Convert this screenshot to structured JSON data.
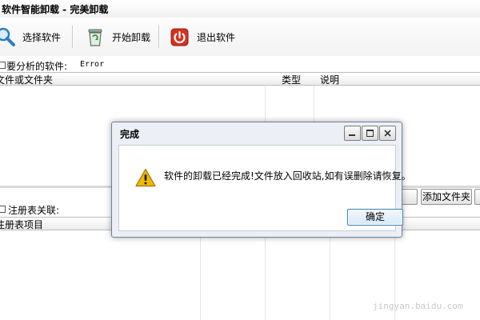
{
  "window": {
    "title": "软件智能卸载 - 完美卸载"
  },
  "toolbar": {
    "select_label": "选择软件",
    "start_label": "开始卸载",
    "exit_label": "退出软件",
    "icons": {
      "select": "search-icon",
      "start": "recycle-bin-icon",
      "exit": "power-icon"
    }
  },
  "target": {
    "label": "要分析的软件:",
    "value": "Error"
  },
  "files_table": {
    "columns": [
      "文件或文件夹",
      "类型",
      "说明"
    ]
  },
  "registry": {
    "label": "注册表关联:",
    "columns": [
      "注册表项目"
    ]
  },
  "side_buttons": {
    "add_folder": "添加文件夹"
  },
  "dialog": {
    "title": "完成",
    "message": "软件的卸载已经完成!文件放入回收站,如有误删除请恢复。",
    "ok_label": "确定",
    "icon": "warning-icon"
  },
  "watermark": "jingyan.baidu.com",
  "colors": {
    "warning": "#f2b705",
    "power_red": "#d8301f",
    "ok_border": "#3c7fb1"
  }
}
